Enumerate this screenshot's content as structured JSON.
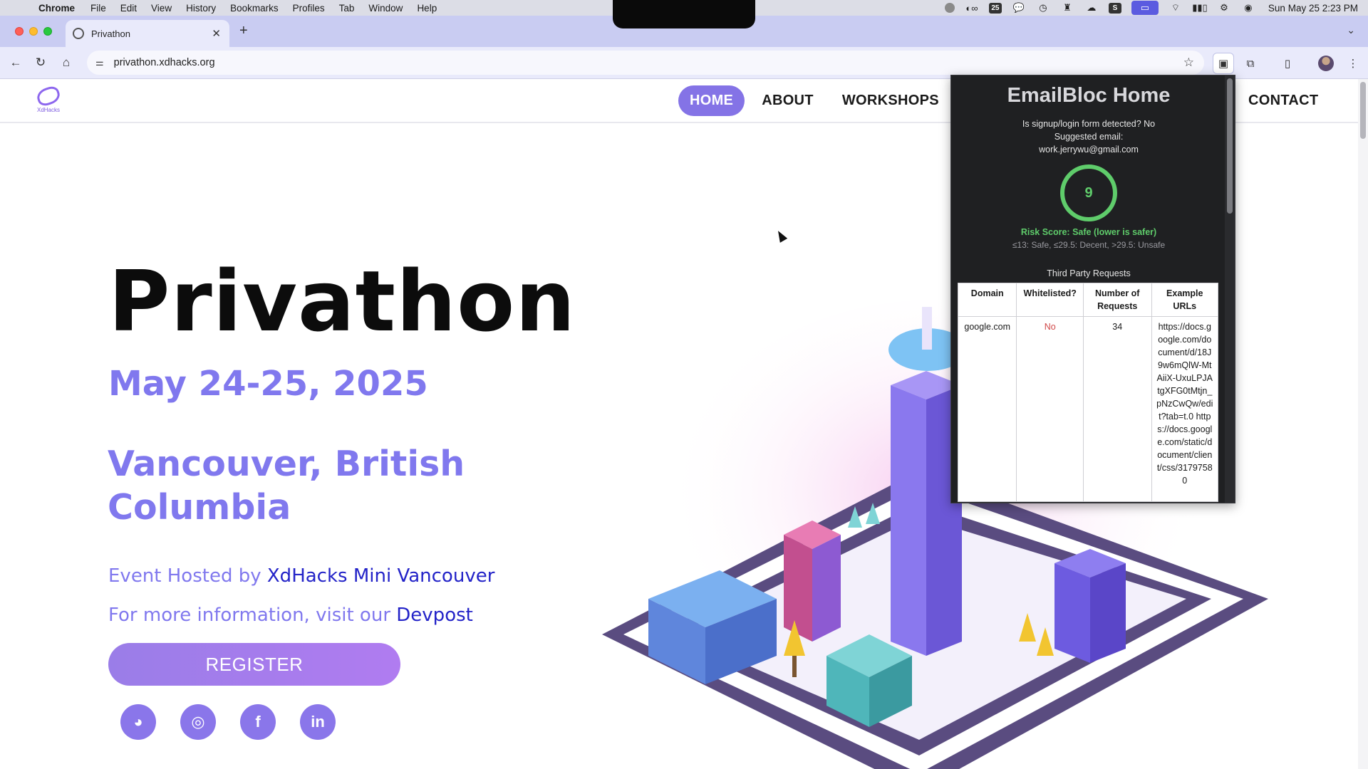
{
  "menubar": {
    "app": "Chrome",
    "items": [
      "File",
      "Edit",
      "View",
      "History",
      "Bookmarks",
      "Profiles",
      "Tab",
      "Window",
      "Help"
    ],
    "status_badge": "25",
    "clock": "Sun May 25  2:23 PM"
  },
  "browser": {
    "tab_title": "Privathon",
    "url": "privathon.xdhacks.org"
  },
  "site": {
    "logo_text": "XdHacks",
    "nav": [
      "HOME",
      "ABOUT",
      "WORKSHOPS"
    ],
    "nav_contact": "CONTACT",
    "title": "Privathon",
    "date": "May 24-25, 2025",
    "location": "Vancouver, British Columbia",
    "hosted_prefix": "Event Hosted by ",
    "hosted_link": "XdHacks Mini Vancouver",
    "info_prefix": "For more information, visit our ",
    "info_link": "Devpost",
    "register": "REGISTER",
    "socials": [
      "discord-icon",
      "instagram-icon",
      "facebook-icon",
      "linkedin-icon"
    ]
  },
  "popup": {
    "title": "EmailBloc Home",
    "form_detected": "Is signup/login form detected? No",
    "suggested_label": "Suggested email:",
    "suggested_email": "work.jerrywu@gmail.com",
    "score": "9",
    "risk": "Risk Score: Safe (lower is safer)",
    "legend": "≤13: Safe, ≤29.5: Decent, >29.5: Unsafe",
    "third_party_title": "Third Party Requests",
    "table": {
      "headers": [
        "Domain",
        "Whitelisted?",
        "Number of Requests",
        "Example URLs"
      ],
      "rows": [
        {
          "domain": "google.com",
          "whitelisted": "No",
          "requests": "34",
          "urls": "https://docs.google.com/document/d/18J9w6mQlW-MtAiiX-UxuLPJAtgXFG0tMtjn_pNzCwQw/edit?tab=t.0 https://docs.google.com/static/document/client/css/31797580"
        }
      ]
    }
  },
  "colors": {
    "accent": "#8078ee",
    "link": "#2323c8",
    "safe": "#5fcc6b",
    "popup_bg": "#1f2022"
  }
}
